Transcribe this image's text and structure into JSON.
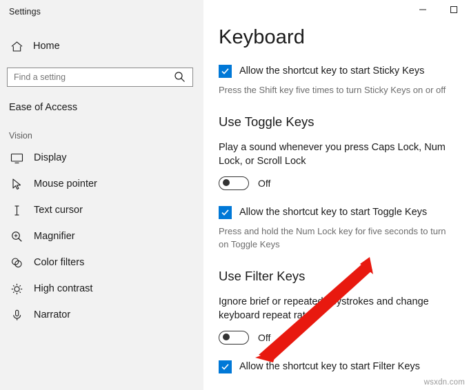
{
  "window": {
    "title": "Settings",
    "controls": {
      "minimize": "─",
      "maximize": "□"
    }
  },
  "sidebar": {
    "home_label": "Home",
    "search": {
      "placeholder": "Find a setting",
      "value": ""
    },
    "section_heading": "Ease of Access",
    "group_label": "Vision",
    "items": [
      {
        "label": "Display",
        "icon": "monitor-icon"
      },
      {
        "label": "Mouse pointer",
        "icon": "cursor-icon"
      },
      {
        "label": "Text cursor",
        "icon": "text-cursor-icon"
      },
      {
        "label": "Magnifier",
        "icon": "magnifier-icon"
      },
      {
        "label": "Color filters",
        "icon": "color-filters-icon"
      },
      {
        "label": "High contrast",
        "icon": "high-contrast-icon"
      },
      {
        "label": "Narrator",
        "icon": "narrator-icon"
      }
    ]
  },
  "main": {
    "page_title": "Keyboard",
    "sticky_keys": {
      "checkbox_label": "Allow the shortcut key to start Sticky Keys",
      "checked": true,
      "help_text": "Press the Shift key five times to turn Sticky Keys on or off"
    },
    "toggle_keys": {
      "heading": "Use Toggle Keys",
      "description": "Play a sound whenever you press Caps Lock, Num Lock, or Scroll Lock",
      "toggle_state": "Off",
      "checkbox_label": "Allow the shortcut key to start Toggle Keys",
      "checked": true,
      "help_text": "Press and hold the Num Lock key for five seconds to turn on Toggle Keys"
    },
    "filter_keys": {
      "heading": "Use Filter Keys",
      "description": "Ignore brief or repeated keystrokes and change keyboard repeat rate",
      "toggle_state": "Off",
      "checkbox_label": "Allow the shortcut key to start Filter Keys",
      "checked": true
    }
  },
  "annotation": {
    "arrow_color": "#e8190f"
  },
  "watermark": "wsxdn.com"
}
